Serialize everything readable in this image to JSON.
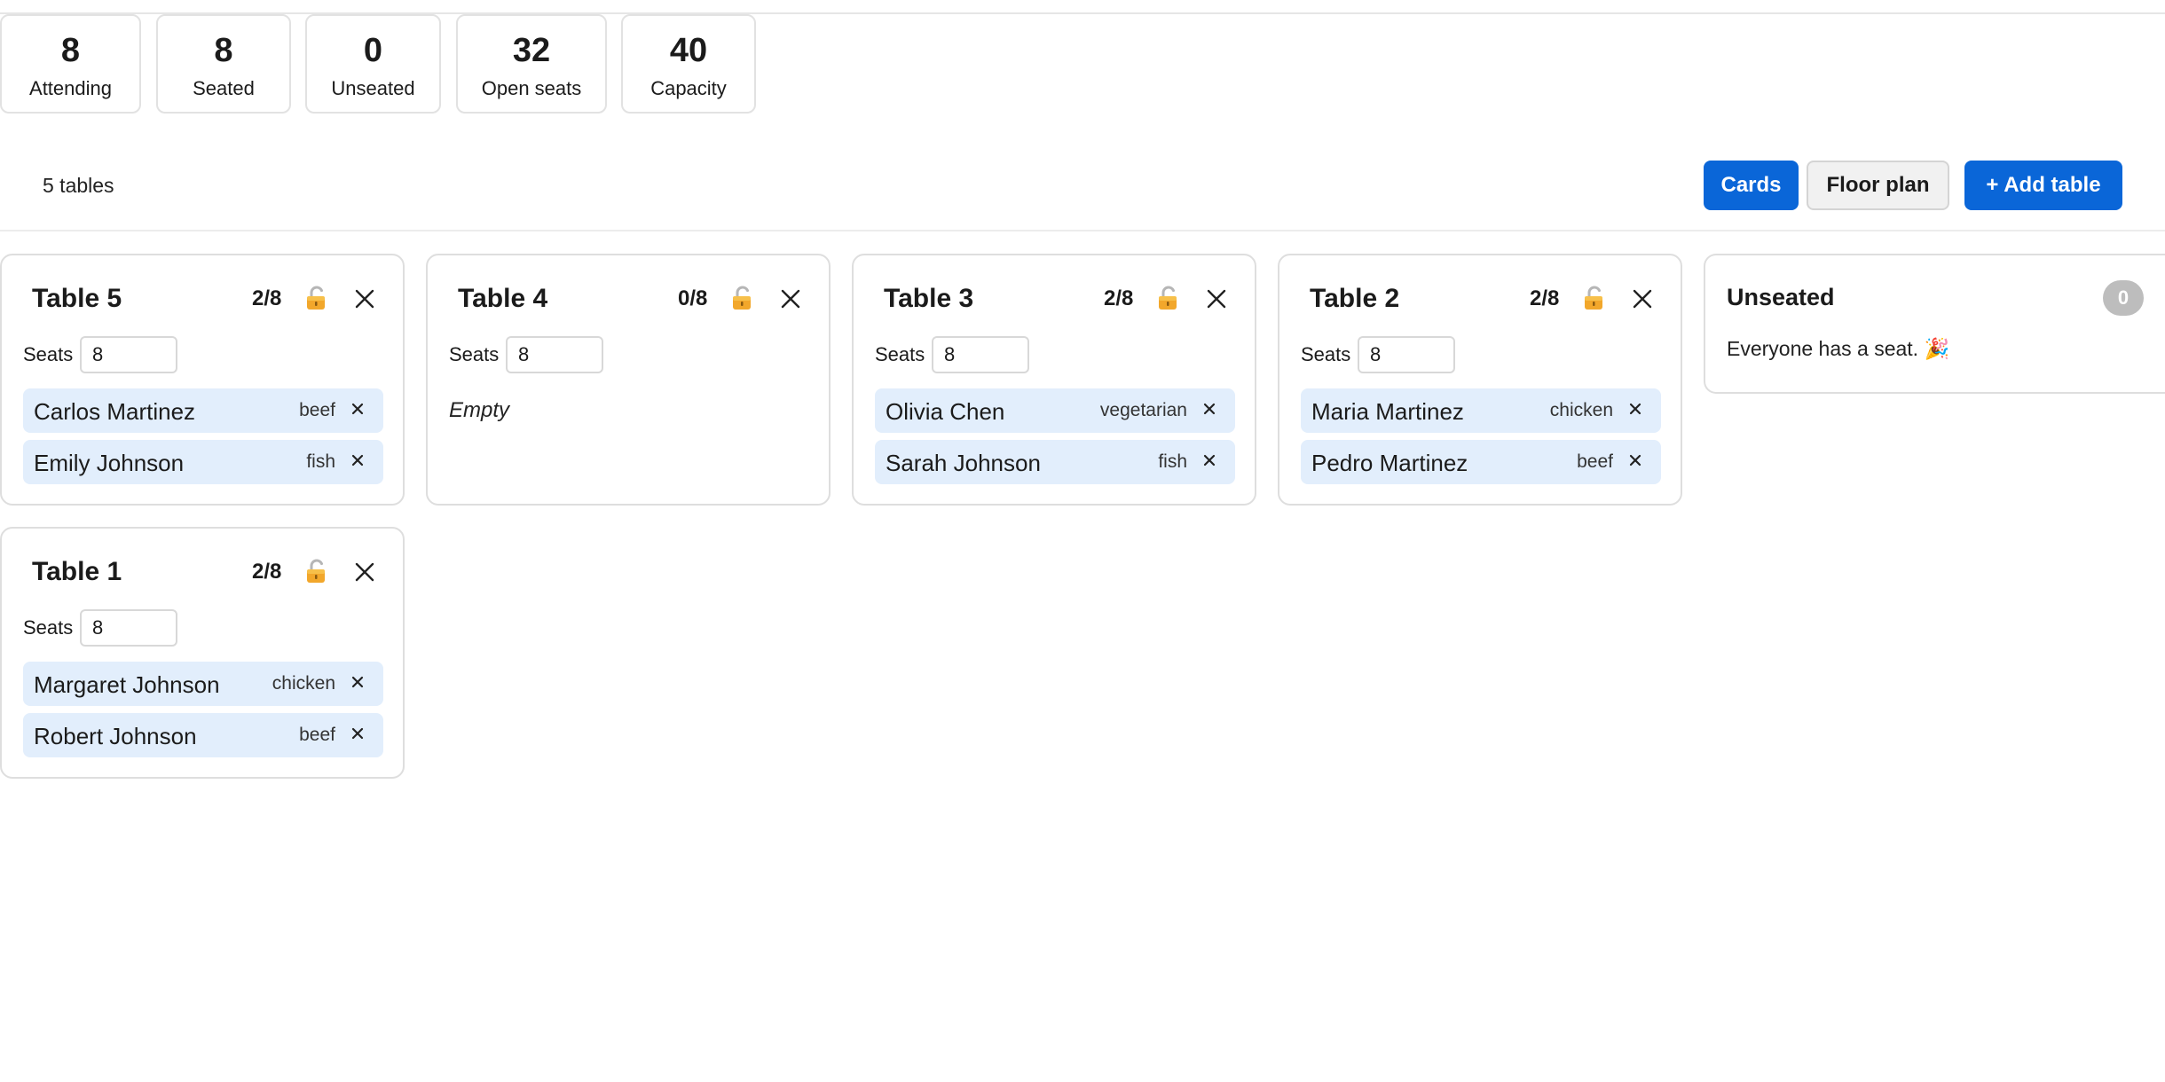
{
  "stats": [
    {
      "value": "8",
      "label": "Attending"
    },
    {
      "value": "8",
      "label": "Seated"
    },
    {
      "value": "0",
      "label": "Unseated"
    },
    {
      "value": "32",
      "label": "Open seats"
    },
    {
      "value": "40",
      "label": "Capacity"
    }
  ],
  "toolbar": {
    "table_count": "5 tables",
    "cards_label": "Cards",
    "floor_plan_label": "Floor plan",
    "add_table_label": "+ Add table"
  },
  "seats_label": "Seats",
  "tables": [
    {
      "name": "Table 5",
      "count": "2/8",
      "seats": "8",
      "guests": [
        {
          "name": "Carlos Martinez",
          "meal": "beef"
        },
        {
          "name": "Emily Johnson",
          "meal": "fish"
        }
      ]
    },
    {
      "name": "Table 4",
      "count": "0/8",
      "seats": "8",
      "empty_text": "Empty",
      "guests": []
    },
    {
      "name": "Table 3",
      "count": "2/8",
      "seats": "8",
      "guests": [
        {
          "name": "Olivia Chen",
          "meal": "vegetarian"
        },
        {
          "name": "Sarah Johnson",
          "meal": "fish"
        }
      ]
    },
    {
      "name": "Table 2",
      "count": "2/8",
      "seats": "8",
      "guests": [
        {
          "name": "Maria Martinez",
          "meal": "chicken"
        },
        {
          "name": "Pedro Martinez",
          "meal": "beef"
        }
      ]
    },
    {
      "name": "Table 1",
      "count": "2/8",
      "seats": "8",
      "guests": [
        {
          "name": "Margaret Johnson",
          "meal": "chicken"
        },
        {
          "name": "Robert Johnson",
          "meal": "beef"
        }
      ]
    }
  ],
  "unseated": {
    "title": "Unseated",
    "count": "0",
    "message": "Everyone has a seat. 🎉"
  },
  "colors": {
    "primary": "#0a66d8",
    "guest_chip": "#e2eefc",
    "badge": "#bdbdbd"
  },
  "icons": {
    "lock": "unlocked-padlock-icon",
    "close": "close-icon",
    "remove": "remove-guest-icon"
  }
}
